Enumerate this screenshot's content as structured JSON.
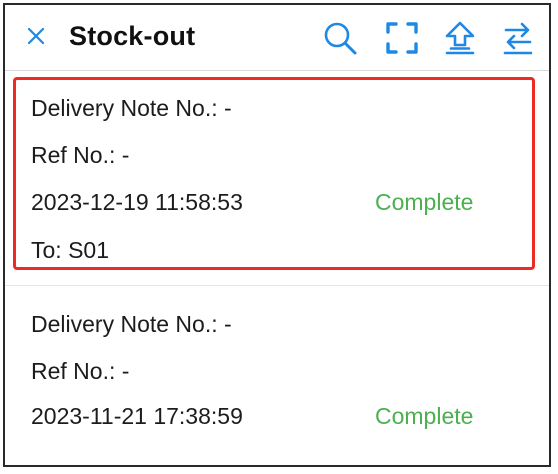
{
  "header": {
    "title": "Stock-out",
    "close_icon": "close-icon",
    "actions": [
      {
        "icon": "search-icon"
      },
      {
        "icon": "scan-icon"
      },
      {
        "icon": "upload-icon"
      },
      {
        "icon": "switch-icon"
      }
    ]
  },
  "colors": {
    "accent": "#1e88e5",
    "status_complete": "#4caf50",
    "highlight": "#ec2b25"
  },
  "records": [
    {
      "delivery_note": "Delivery Note No.: -",
      "ref_no": "Ref No.: -",
      "datetime": "2023-12-19 11:58:53",
      "status": "Complete",
      "to": "To: S01"
    },
    {
      "delivery_note": "Delivery Note No.: -",
      "ref_no": "Ref No.: -",
      "datetime": "2023-11-21 17:38:59",
      "status": "Complete"
    }
  ]
}
